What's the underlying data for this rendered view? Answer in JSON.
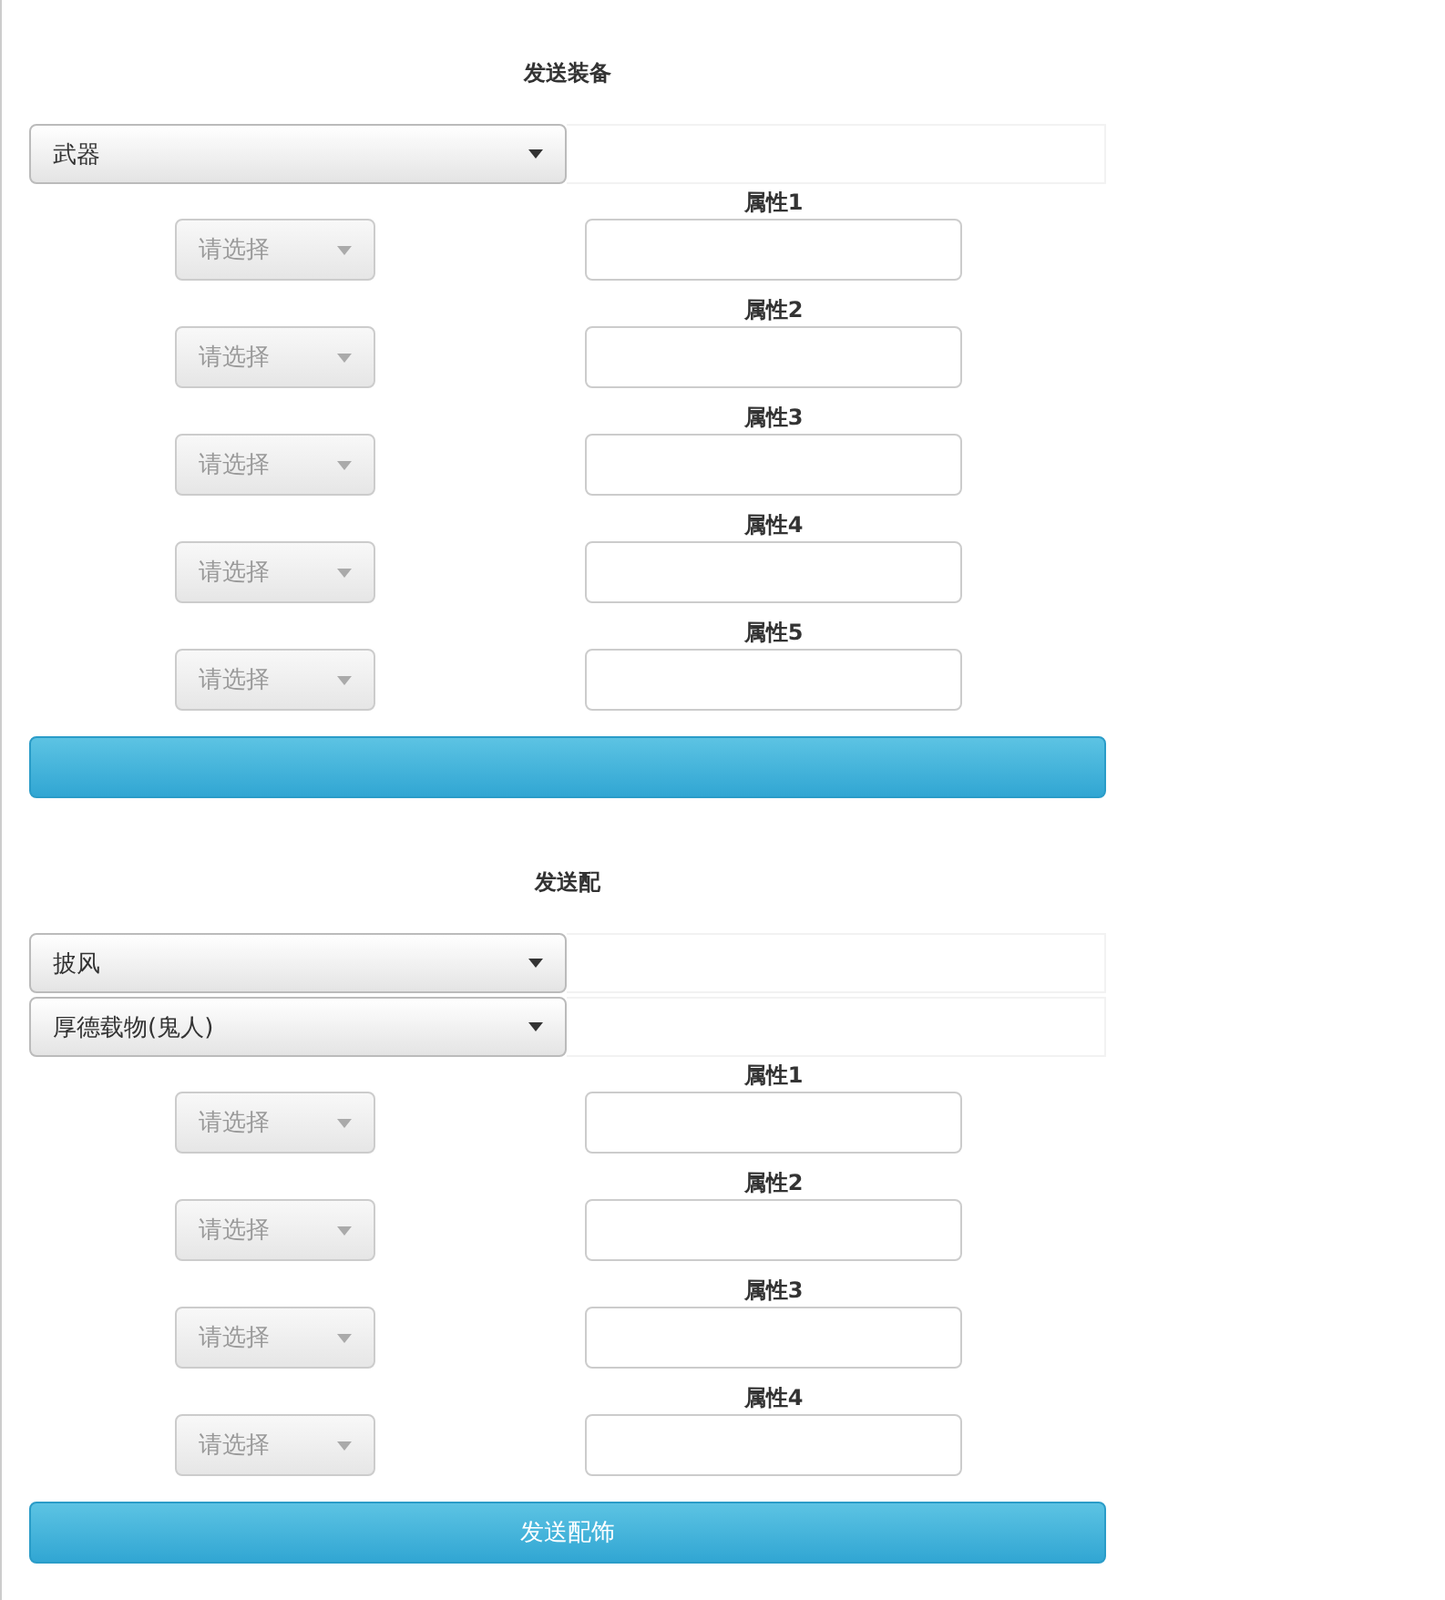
{
  "sections": [
    {
      "title": "发送装备",
      "selects": [
        "武器"
      ],
      "attributes": [
        {
          "label": "属性1",
          "placeholder": "请选择"
        },
        {
          "label": "属性2",
          "placeholder": "请选择"
        },
        {
          "label": "属性3",
          "placeholder": "请选择"
        },
        {
          "label": "属性4",
          "placeholder": "请选择"
        },
        {
          "label": "属性5",
          "placeholder": "请选择"
        }
      ]
    },
    {
      "title": "发送配",
      "selects": [
        "披风",
        "厚德载物(鬼人)"
      ],
      "attributes": [
        {
          "label": "属性1",
          "placeholder": "请选择"
        },
        {
          "label": "属性2",
          "placeholder": "请选择"
        },
        {
          "label": "属性3",
          "placeholder": "请选择"
        },
        {
          "label": "属性4",
          "placeholder": "请选择"
        }
      ],
      "button": "发送配饰"
    }
  ]
}
